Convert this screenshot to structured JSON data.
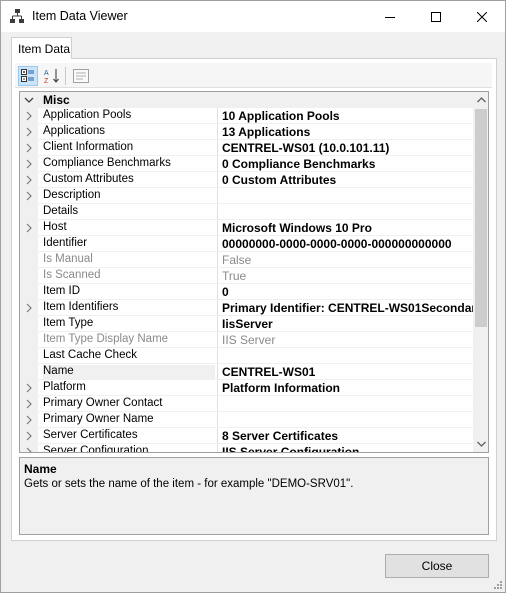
{
  "window": {
    "title": "Item Data Viewer",
    "icon": "network-icon"
  },
  "tabs": [
    {
      "label": "Item Data",
      "active": true
    }
  ],
  "toolbar": {
    "buttons": [
      {
        "name": "categorized",
        "icon": "categorized-icon",
        "active": true
      },
      {
        "name": "alphabetical",
        "icon": "sort-az-icon",
        "active": false
      },
      {
        "name": "property-pages",
        "icon": "property-pages-icon",
        "active": false
      }
    ]
  },
  "grid": {
    "category": "Misc",
    "rows": [
      {
        "name": "Application Pools",
        "value": "10 Application Pools",
        "expandable": true,
        "bold": true,
        "dim": false
      },
      {
        "name": "Applications",
        "value": "13 Applications",
        "expandable": true,
        "bold": true,
        "dim": false
      },
      {
        "name": "Client Information",
        "value": "CENTREL-WS01 (10.0.101.11)",
        "expandable": true,
        "bold": true,
        "dim": false
      },
      {
        "name": "Compliance Benchmarks",
        "value": "0 Compliance Benchmarks",
        "expandable": true,
        "bold": true,
        "dim": false
      },
      {
        "name": "Custom Attributes",
        "value": "0 Custom Attributes",
        "expandable": true,
        "bold": true,
        "dim": false
      },
      {
        "name": "Description",
        "value": "",
        "expandable": true,
        "bold": false,
        "dim": false
      },
      {
        "name": "Details",
        "value": "",
        "expandable": false,
        "bold": false,
        "dim": false
      },
      {
        "name": "Host",
        "value": "Microsoft Windows 10 Pro",
        "expandable": true,
        "bold": true,
        "dim": false
      },
      {
        "name": "Identifier",
        "value": "00000000-0000-0000-0000-000000000000",
        "expandable": false,
        "bold": true,
        "dim": false
      },
      {
        "name": "Is Manual",
        "value": "False",
        "expandable": false,
        "bold": false,
        "dim": true
      },
      {
        "name": "Is Scanned",
        "value": "True",
        "expandable": false,
        "bold": false,
        "dim": true
      },
      {
        "name": "Item ID",
        "value": "0",
        "expandable": false,
        "bold": true,
        "dim": false
      },
      {
        "name": "Item Identifiers",
        "value": "Primary Identifier: CENTREL-WS01Secondar",
        "expandable": true,
        "bold": true,
        "dim": false
      },
      {
        "name": "Item Type",
        "value": "IisServer",
        "expandable": false,
        "bold": true,
        "dim": false
      },
      {
        "name": "Item Type Display Name",
        "value": "IIS Server",
        "expandable": false,
        "bold": false,
        "dim": true
      },
      {
        "name": "Last Cache Check",
        "value": "",
        "expandable": false,
        "bold": false,
        "dim": false
      },
      {
        "name": "Name",
        "value": "CENTREL-WS01",
        "expandable": false,
        "bold": true,
        "dim": false,
        "selected": true
      },
      {
        "name": "Platform",
        "value": "Platform Information",
        "expandable": true,
        "bold": true,
        "dim": false
      },
      {
        "name": "Primary Owner Contact",
        "value": "",
        "expandable": true,
        "bold": false,
        "dim": false
      },
      {
        "name": "Primary Owner Name",
        "value": "",
        "expandable": true,
        "bold": false,
        "dim": false
      },
      {
        "name": "Server Certificates",
        "value": "8 Server Certificates",
        "expandable": true,
        "bold": true,
        "dim": false
      },
      {
        "name": "Server Configuration",
        "value": "IIS Server Configuration",
        "expandable": true,
        "bold": true,
        "dim": false
      }
    ]
  },
  "help": {
    "title": "Name",
    "description": "Gets or sets the name of the item - for example \"DEMO-SRV01\"."
  },
  "footer": {
    "close_label": "Close"
  }
}
